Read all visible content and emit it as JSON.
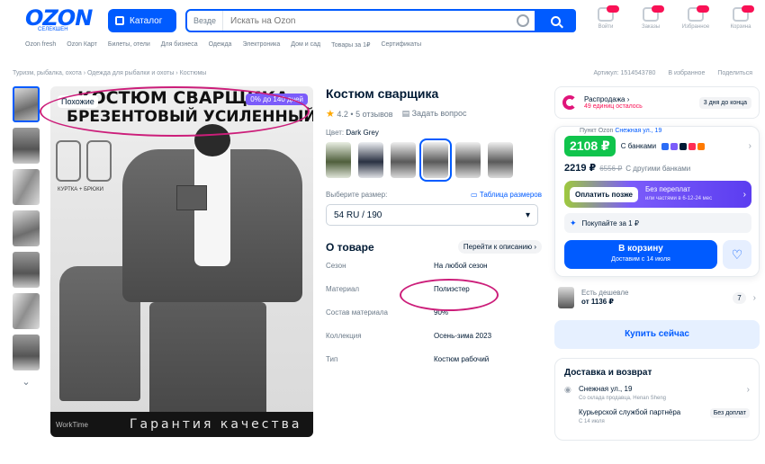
{
  "header": {
    "logo": "OZON",
    "logo_sub": "СЕЛЕКШЕН",
    "catalog": "Каталог",
    "search_scope": "Везде",
    "search_placeholder": "Искать на Ozon",
    "icons": [
      {
        "name": "login-icon",
        "label": "Войти"
      },
      {
        "name": "orders-icon",
        "label": "Заказы"
      },
      {
        "name": "favorites-icon",
        "label": "Избранное"
      },
      {
        "name": "cart-icon",
        "label": "Корзина"
      }
    ]
  },
  "subnav": {
    "items": [
      "Ozon fresh",
      "Ozon Карт",
      "Билеты, отели",
      "Для бизнеса",
      "Одежда",
      "Электроника",
      "Дом и сад",
      "Товары за 1₽",
      "Сертификаты"
    ],
    "right": "Пункт Ozon",
    "right_link": "Снежная ул., 19"
  },
  "breadcrumbs": "Туризм, рыбалка, охота  ›  Одежда для рыбалки и охоты  ›  Костюмы",
  "crumb_right": [
    "Артикул: 1514543780",
    "В избранное",
    "Поделиться"
  ],
  "hero": {
    "title_line1": "КОСТЮМ СВАРЩИКА",
    "title_line2": "БРЕЗЕНТОВЫЙ УСИЛЕННЫЙ",
    "similar": "Похожие",
    "installment": "0% до 140 дней",
    "bottom_brand": "WorkTime",
    "bottom_quality": "Гарантия качества",
    "small_label": "КУРТКА + БРЮКИ"
  },
  "product": {
    "title": "Костюм сварщика",
    "rating": "4.2",
    "reviews": "5 отзывов",
    "ask": "Задать вопрос",
    "color_label": "Цвет:",
    "color_value": "Dark Grey",
    "size_label": "Выберите размер:",
    "size_table": "Таблица размеров",
    "size_value": "54 RU / 190",
    "about_title": "О товаре",
    "about_link": "Перейти к описанию",
    "specs": [
      {
        "k": "Сезон",
        "v": "На любой сезон"
      },
      {
        "k": "Материал",
        "v": "Полиэстер"
      },
      {
        "k": "Состав материала",
        "v": "90%"
      },
      {
        "k": "Коллекция",
        "v": "Осень-зима 2023"
      },
      {
        "k": "Тип",
        "v": "Костюм рабочий"
      }
    ]
  },
  "buybox": {
    "sale_title": "Распродажа",
    "sale_count": "49 единиц осталось",
    "sale_days": "3 дня до конца",
    "price_card": "2108 ₽",
    "with_banks": "С банками",
    "price_other": "2219 ₽",
    "price_old": "6556 ₽",
    "other_banks": "С другими банками",
    "pay_later_btn": "Оплатить позже",
    "pay_later_title": "Без переплат",
    "pay_later_sub": "или частями в 6-12-24 мес",
    "buy_for_1": "Покупайте за 1 ₽",
    "cart_btn": "В корзину",
    "cart_sub": "Доставим с 14 июля",
    "cheaper_label": "Есть дешевле",
    "cheaper_price": "от 1136 ₽",
    "cheaper_count": "7",
    "buy_now": "Купить сейчас"
  },
  "delivery": {
    "title": "Доставка и возврат",
    "address": "Снежная ул., 19",
    "address_sub": "Со склада продавца, Henan Sheng",
    "courier": "Курьерской службой партнёра",
    "courier_sub": "С 14 июля",
    "courier_badge": "Без доплат"
  },
  "colors": {
    "brand": "#005bff",
    "annotation": "#cc1e7a",
    "price_green": "#10c44c",
    "sale_pink": "#f91155"
  }
}
